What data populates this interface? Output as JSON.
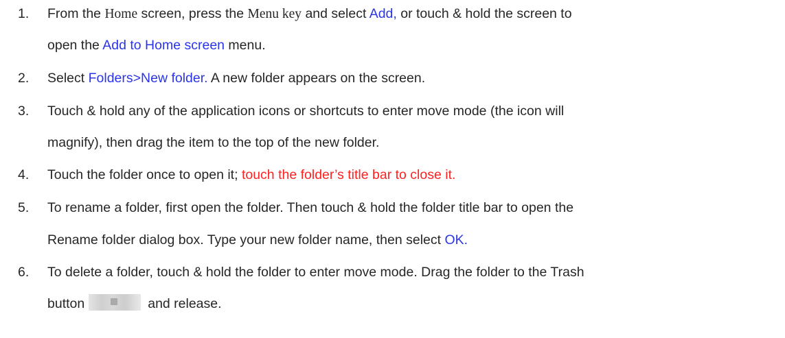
{
  "steps": [
    {
      "num": "1.",
      "line1_a": "From the ",
      "line1_home": "Home",
      "line1_b": " screen, press the ",
      "line1_menu": "Menu key",
      "line1_c": " and select ",
      "line1_add": "Add,",
      "line1_d": " or touch & hold the screen to",
      "line2_a": "open the ",
      "line2_link": "Add to Home screen",
      "line2_b": " menu."
    },
    {
      "num": "2.",
      "line1_a": "Select ",
      "line1_link": "Folders>New folder.",
      "line1_b": " A new folder appears on the screen."
    },
    {
      "num": "3.",
      "line1": "Touch & hold any of the application icons or shortcuts to enter move mode (the icon will",
      "line2": "magnify), then drag the item to the top of the new folder."
    },
    {
      "num": "4.",
      "line1_a": "Touch the folder once to open it; ",
      "line1_red": "touch the folder’s title bar to close it."
    },
    {
      "num": "5.",
      "line1": "To rename a folder, first open the folder. Then touch & hold the folder title bar to open the",
      "line2_a": "Rename folder dialog box. Type your new folder name, then select ",
      "line2_ok": "OK."
    },
    {
      "num": "6.",
      "line1": "To delete a folder, touch & hold the folder to enter move mode. Drag the folder to the Trash",
      "line2_a": "button",
      "line2_b": "and release."
    }
  ],
  "colors": {
    "text": "#262626",
    "link_blue": "#2b35e8",
    "highlight_red": "#ff2020"
  },
  "icons": [
    "trash-button-icon"
  ]
}
